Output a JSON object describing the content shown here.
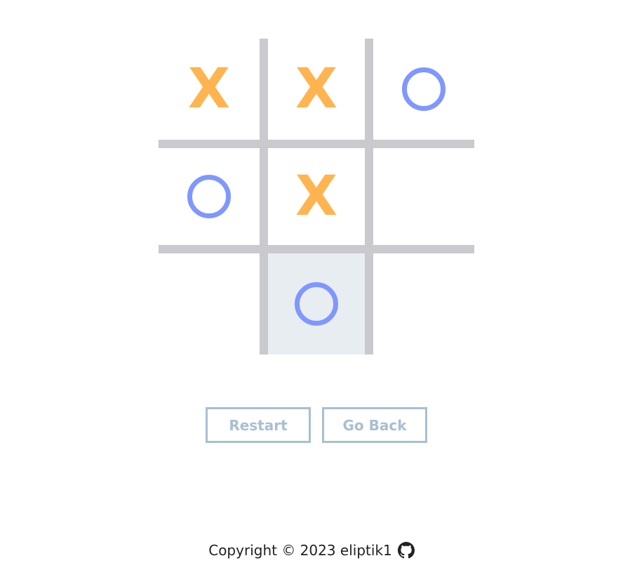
{
  "board": {
    "cells": [
      "X",
      "X",
      "O",
      "O",
      "X",
      "",
      "",
      "O",
      ""
    ],
    "highlighted_cell": 7
  },
  "colors": {
    "x_mark": "#ffb44f",
    "o_mark": "#7f97ff",
    "grid": "#c9c9ce",
    "highlight": "#e8edf2",
    "button": "#a8bfd1"
  },
  "controls": {
    "restart_label": "Restart",
    "go_back_label": "Go Back"
  },
  "footer": {
    "copyright": "Copyright © 2023 eliptik1",
    "icon": "github-icon"
  }
}
